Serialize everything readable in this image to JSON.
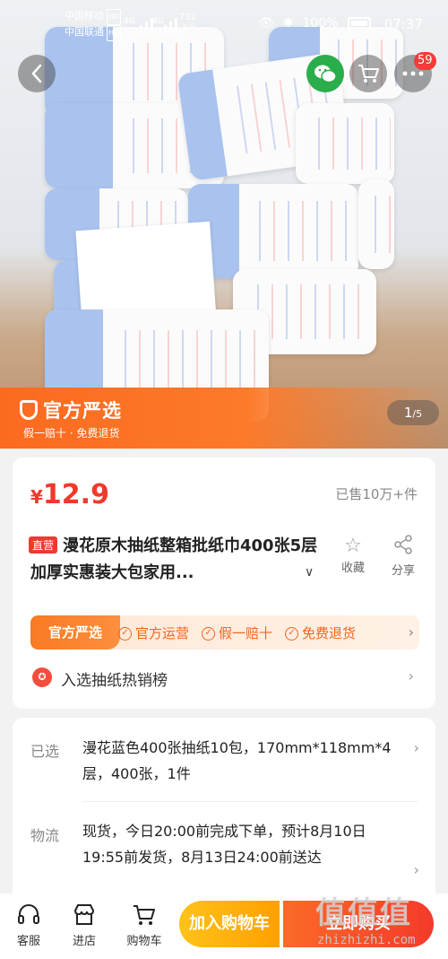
{
  "status_bar": {
    "carrier1": "中国移动",
    "carrier2": "中国联通",
    "hd": "HD",
    "net1": "4G",
    "net2": "4G",
    "speed_value": "732",
    "speed_unit": "K/s",
    "battery": "100%",
    "time": "07:37"
  },
  "hero": {
    "badge_count": "59",
    "pager_current": "1",
    "pager_total": "/5",
    "official_title": "官方严选",
    "official_sub": "假一赔十 · 免费退货"
  },
  "product": {
    "currency": "¥",
    "price": "12.9",
    "sold": "已售10万+件",
    "tag": "直营",
    "title": "漫花原木抽纸整箱批纸巾400张5层加厚实惠装大包家用...",
    "fav_label": "收藏",
    "share_label": "分享"
  },
  "yanxuan": {
    "brand": "官方严选",
    "items": [
      "官方运营",
      "假一赔十",
      "免费退货"
    ]
  },
  "rank": {
    "text": "入选抽纸热销榜"
  },
  "selected": {
    "label": "已选",
    "value": "漫花蓝色400张抽纸10包，170mm*118mm*4层，400张，1件"
  },
  "logistics": {
    "label": "物流",
    "value": "现货，今日20:00前完成下单，预计8月10日19:55前发货，8月13日24:00前送达"
  },
  "bottom": {
    "kefu": "客服",
    "shop": "进店",
    "cart": "购物车",
    "add_cart": "加入购物车",
    "buy_now": "立即购买"
  },
  "watermark": {
    "logo": "值值值",
    "url": "zhizhizhi.com"
  },
  "colors": {
    "accent": "#f0392b",
    "orange": "#fc6a1f",
    "yellow": "#ffb000"
  }
}
